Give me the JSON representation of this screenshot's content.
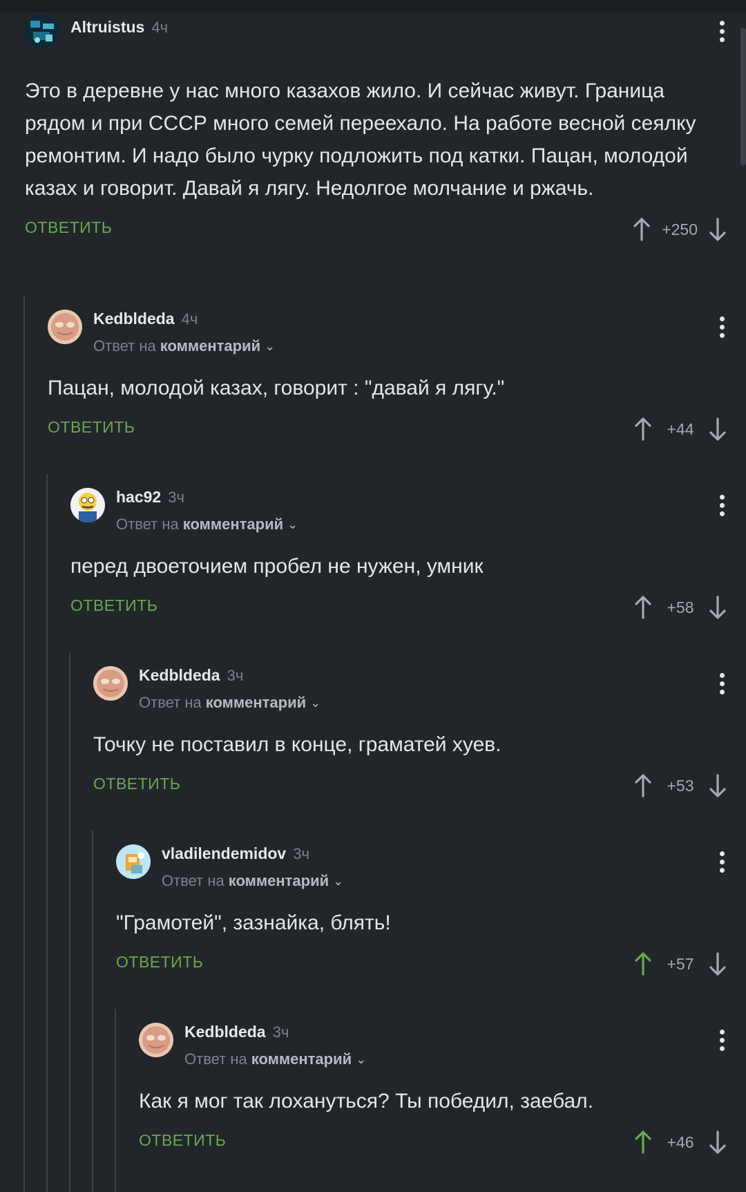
{
  "comments": [
    {
      "author": "Altruistus",
      "time": "4ч",
      "text": "Это в деревне у нас много казахов жило. И сейчас живут. Граница рядом и при СССР много семей переехало. На работе весной сеялку ремонтим. И надо было чурку подложить под катки. Пацан, молодой казах и говорит. Давай я лягу. Недолгое молчание и ржачь.",
      "reply_label": "ОТВЕТИТЬ",
      "score": "+250"
    },
    {
      "author": "Kedbldeda",
      "time": "4ч",
      "reply_to_prefix": "Ответ на",
      "reply_to_link": "комментарий",
      "text": "Пацан, молодой казах, говорит : \"давай я лягу.\"",
      "reply_label": "ОТВЕТИТЬ",
      "score": "+44"
    },
    {
      "author": "hac92",
      "time": "3ч",
      "reply_to_prefix": "Ответ на",
      "reply_to_link": "комментарий",
      "text": "перед двоеточием пробел не нужен, умник",
      "reply_label": "ОТВЕТИТЬ",
      "score": "+58"
    },
    {
      "author": "Kedbldeda",
      "time": "3ч",
      "reply_to_prefix": "Ответ на",
      "reply_to_link": "комментарий",
      "text": "Точку не поставил в конце, граматей хуев.",
      "reply_label": "ОТВЕТИТЬ",
      "score": "+53"
    },
    {
      "author": "vladilendemidov",
      "time": "3ч",
      "reply_to_prefix": "Ответ на",
      "reply_to_link": "комментарий",
      "text": "\"Грамотей\", зазнайка, блять!",
      "reply_label": "ОТВЕТИТЬ",
      "score": "+57",
      "upvoted": true
    },
    {
      "author": "Kedbldeda",
      "time": "3ч",
      "reply_to_prefix": "Ответ на",
      "reply_to_link": "комментарий",
      "text": "Как я мог так лохануться? Ты победил, заебал.",
      "reply_label": "ОТВЕТИТЬ",
      "score": "+46",
      "upvoted": true
    }
  ],
  "colors": {
    "background": "#22262b",
    "reply_link": "#6aa84f",
    "upvote_active": "#6aa84f",
    "arrow_default": "#a4aab1",
    "thread_line": "#3f444b"
  },
  "icons": [
    "more-vertical-icon",
    "chevron-down-icon",
    "upvote-arrow-icon",
    "downvote-arrow-icon"
  ]
}
